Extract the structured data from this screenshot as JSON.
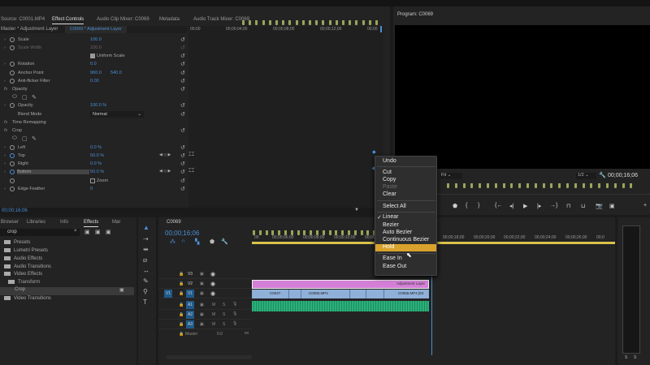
{
  "effect_controls": {
    "tabs": [
      "Source: C0001.MP4",
      "Effect Controls",
      "Audio Clip Mixer: C0069",
      "Metadata",
      "Audio Track Mixer: C0069"
    ],
    "master_label": "Master * Adjustment Layer",
    "clip_label": "C0069 * Adjustment Layer",
    "ruler": [
      "00;00",
      "00;00;04;00",
      "00;00;08;00",
      "00;00;12;00",
      "00;00"
    ],
    "rows": [
      {
        "label": "Scale",
        "value": "100.0"
      },
      {
        "label": "Scale Width",
        "value": "100.0"
      },
      {
        "label": "Uniform Scale",
        "value": ""
      },
      {
        "label": "Rotation",
        "value": "0.0"
      },
      {
        "label": "Anchor Point",
        "value": "960.0",
        "value2": "540.0"
      },
      {
        "label": "Anti-flicker Filter",
        "value": "0.00"
      },
      {
        "label": "Opacity",
        "value": ""
      },
      {
        "label": "",
        "value": ""
      },
      {
        "label": "Opacity",
        "value": "100.0 %"
      },
      {
        "label": "Blend Mode",
        "value": "Normal"
      },
      {
        "label": "Time Remapping",
        "value": ""
      },
      {
        "label": "Crop",
        "value": ""
      },
      {
        "label": "",
        "value": ""
      },
      {
        "label": "Left",
        "value": "0.0 %"
      },
      {
        "label": "Top",
        "value": "50.0 %"
      },
      {
        "label": "Right",
        "value": "0.0 %"
      },
      {
        "label": "Bottom",
        "value": "50.0 %"
      },
      {
        "label": "Zoom",
        "value": ""
      },
      {
        "label": "Edge Feather",
        "value": "0"
      }
    ],
    "timecode": "00;00;16;06"
  },
  "program": {
    "title": "Program: C0069",
    "fit": "Fit",
    "resolution": "1/2",
    "timecode": "00;00;16;06"
  },
  "context_menu": {
    "items": [
      "Undo",
      "Cut",
      "Copy",
      "Paste",
      "Clear",
      "Select All",
      "Linear",
      "Bezier",
      "Auto Bezier",
      "Continuous Bezier",
      "Hold",
      "Ease In",
      "Ease Out"
    ],
    "checked": "Linear",
    "highlighted": "Hold",
    "disabled": [
      "Paste"
    ],
    "check_mark": "✓"
  },
  "effects_panel": {
    "tabs": [
      "Browser",
      "Libraries",
      "Info",
      "Effects",
      "Mar"
    ],
    "search": "crop",
    "items": [
      "Presets",
      "Lumetri Presets",
      "Audio Effects",
      "Audio Transitions",
      "Video Effects",
      "Transform",
      "Crop",
      "Video Transitions"
    ]
  },
  "timeline": {
    "title": "C0069",
    "timecode": "00;00;16;06",
    "ruler": [
      "00",
      "00;00;06;00",
      "00;00;08;00",
      "00;00;10;00",
      "00;00;12",
      "00;00;18;00",
      "00;00;20;00",
      "00;00;22;00",
      "00;00;24;00",
      "00;00;26;00",
      "00;0"
    ],
    "tracks": [
      "V3",
      "V2",
      "V1",
      "A1",
      "A2",
      "A3"
    ],
    "source_patch": "V1",
    "master_label": "Master",
    "master_value": "0.0",
    "mute": "M",
    "solo": "S",
    "clips": {
      "adjustment": "Adjustment Layer",
      "v1": [
        "C0047",
        "C0050.MP4",
        "C0056.MP4 [63"
      ]
    }
  },
  "colors": {
    "accent": "#4a8fd6",
    "highlight": "#d9a22c",
    "adjustment": "#d47fd6",
    "video_clip": "#8fb0d8",
    "audio_clip": "#2bb07c",
    "playhead": "#d9c24a"
  }
}
